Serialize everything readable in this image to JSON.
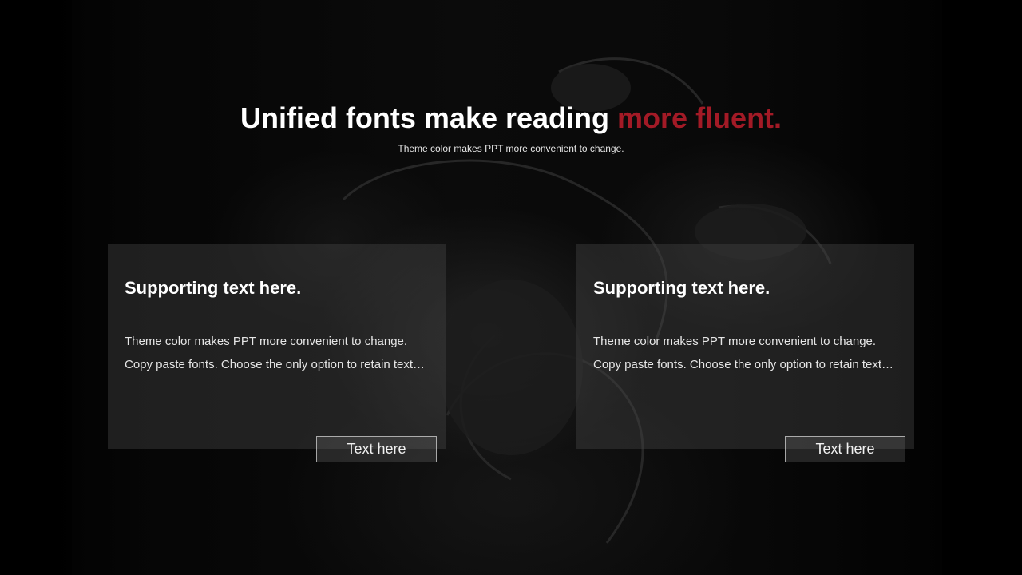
{
  "slide": {
    "title_main": "Unified fonts make reading ",
    "title_accent": "more fluent.",
    "subtitle": "Theme color makes PPT more convenient to change.",
    "accent_color": "#a31a26"
  },
  "cards": [
    {
      "heading": "Supporting text here.",
      "body": "Theme color makes PPT more convenient to change. Copy paste fonts. Choose the only option to retain text…",
      "button_label": "Text here"
    },
    {
      "heading": "Supporting text here.",
      "body": "Theme color makes PPT more convenient to change. Copy paste fonts. Choose the only option to retain text…",
      "button_label": "Text here"
    }
  ]
}
